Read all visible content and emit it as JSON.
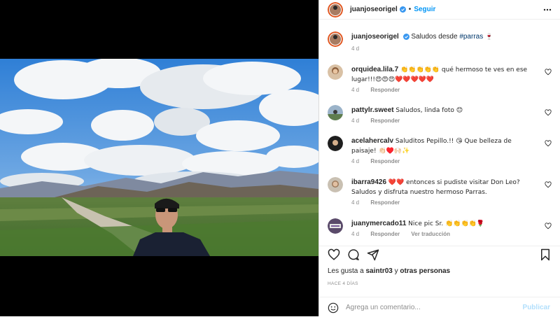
{
  "header": {
    "username": "juanjoseorigel",
    "separator": "•",
    "follow_label": "Seguir"
  },
  "caption": {
    "username": "juanjoseorigel",
    "text": "Saludos desde",
    "hashtag": "#parras",
    "emoji": "🍷",
    "time": "4 d"
  },
  "comments": [
    {
      "username": "orquidea.lila.7",
      "text": "👏👏👏👏👏 qué hermoso te ves en ese lugar!!!😍😍😍❤️❤️❤️❤️❤️",
      "time": "4 d",
      "reply": "Responder",
      "translate": ""
    },
    {
      "username": "pattylr.sweet",
      "text": "Saludos, linda foto 😊",
      "time": "4 d",
      "reply": "Responder",
      "translate": ""
    },
    {
      "username": "acelahercalv",
      "text": "Saluditos Pepillo.!! 😘 Que belleza de paisaje! 👏🏻♥️🙌🏻✨",
      "time": "4 d",
      "reply": "Responder",
      "translate": ""
    },
    {
      "username": "ibarra9426",
      "text": "❤️❤️ entonces si pudiste visitar Don Leo? Saludos y disfruta nuestro hermoso Parras.",
      "time": "4 d",
      "reply": "Responder",
      "translate": ""
    },
    {
      "username": "juanymercado11",
      "text": "Nice pic Sr. 👏👏👏👏🌹",
      "time": "4 d",
      "reply": "Responder",
      "translate": "Ver traducción"
    }
  ],
  "likes": {
    "prefix": "Les gusta a",
    "user": "saintr03",
    "conj": "y",
    "others": "otras personas"
  },
  "posted_ago": "HACE 4 DÍAS",
  "composer": {
    "placeholder": "Agrega un comentario...",
    "publish_label": "Publicar"
  },
  "colors": {
    "accent": "#0095f6",
    "publish_disabled": "#b2dffc",
    "verified": "#3897f0",
    "heart_red": "#ed4956"
  },
  "icons": [
    "more-options-icon",
    "verified-badge-icon",
    "heart-icon",
    "comment-icon",
    "share-icon",
    "save-icon",
    "emoji-icon"
  ]
}
